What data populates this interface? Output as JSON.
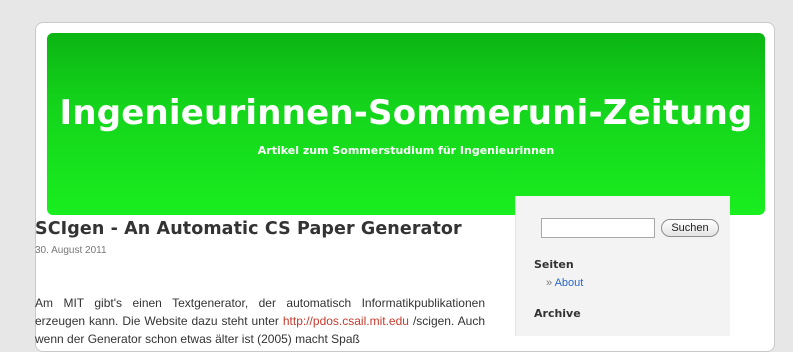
{
  "header": {
    "title": "Ingenieurinnen-Sommeruni-Zeitung",
    "description": "Artikel zum Sommerstudium für Ingenieurinnen",
    "color_top": "#0bb513",
    "color_bottom": "#19ee1f"
  },
  "sidebar": {
    "search": {
      "value": "",
      "button_label": "Suchen"
    },
    "pages": {
      "title": "Seiten",
      "items": [
        {
          "bullet": "»",
          "label": "About"
        }
      ]
    },
    "archive": {
      "title": "Archive"
    }
  },
  "post": {
    "title": "SCIgen - An Automatic CS Paper Generator",
    "date": "30. August 2011",
    "body_line1": "Am MIT gibt's einen Textgenerator, der automatisch Informatikpublikationen",
    "body_line2_prefix": "erzeugen kann. Die Website dazu steht unter ",
    "link_text": "http://pdos.csail.mit.edu",
    "link_color": "#c43a2c",
    "body_line3": "/scigen. Auch wenn der Generator schon etwas älter ist (2005) macht Spaß"
  },
  "colors": {
    "background": "#e7e7e7",
    "link": "#2b67c5"
  }
}
